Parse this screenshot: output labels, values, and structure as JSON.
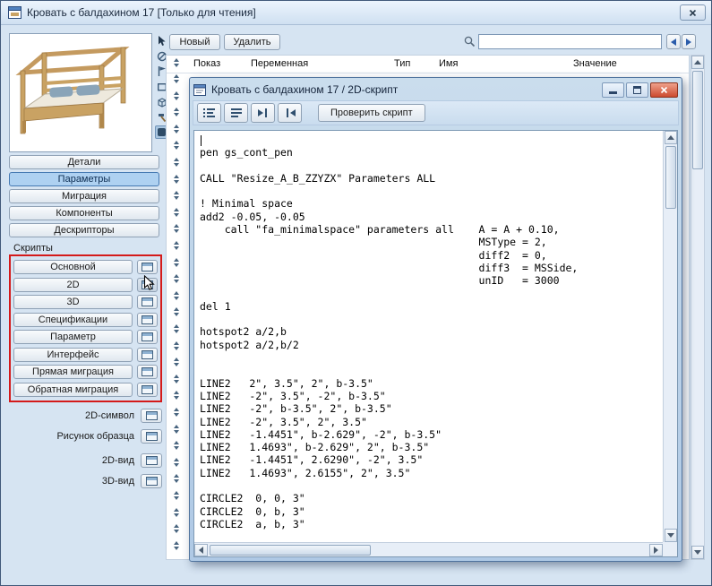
{
  "window": {
    "title": "Кровать с балдахином 17 [Только для чтения]"
  },
  "toolbar": {
    "new": "Новый",
    "delete": "Удалить",
    "search_value": ""
  },
  "param_table": {
    "columns": [
      "Показ",
      "Переменная",
      "Тип",
      "Имя",
      "Значение"
    ]
  },
  "sidebar": {
    "tabs": [
      "Детали",
      "Параметры",
      "Миграция",
      "Компоненты",
      "Дескрипторы"
    ],
    "selected_tab": "Параметры",
    "scripts_label": "Скрипты",
    "script_buttons": [
      "Основной",
      "2D",
      "3D",
      "Спецификации",
      "Параметр",
      "Интерфейс",
      "Прямая миграция",
      "Обратная миграция"
    ],
    "preview_rows": [
      "2D-символ",
      "Рисунок образца",
      "2D-вид",
      "3D-вид"
    ]
  },
  "script_window": {
    "title": "Кровать с балдахином 17 / 2D-скрипт",
    "check_script": "Проверить скрипт",
    "code": "\npen gs_cont_pen\n\nCALL \"Resize_A_B_ZZYZX\" Parameters ALL\n\n! Minimal space\nadd2 -0.05, -0.05\n    call \"fa_minimalspace\" parameters all    A = A + 0.10,\n                                             MSType = 2,\n                                             diff2  = 0,\n                                             diff3  = MSSide,\n                                             unID   = 3000\n\ndel 1\n\nhotspot2 a/2,b\nhotspot2 a/2,b/2\n\n\nLINE2   2\", 3.5\", 2\", b-3.5\"\nLINE2   -2\", 3.5\", -2\", b-3.5\"\nLINE2   -2\", b-3.5\", 2\", b-3.5\"\nLINE2   -2\", 3.5\", 2\", 3.5\"\nLINE2   -1.4451\", b-2.629\", -2\", b-3.5\"\nLINE2   1.4693\", b-2.629\", 2\", b-3.5\"\nLINE2   -1.4451\", 2.6290\", -2\", 3.5\"\nLINE2   1.4693\", 2.6155\", 2\", 3.5\"\n\nCIRCLE2  0, 0, 3\"\nCIRCLE2  0, b, 3\"\nCIRCLE2  a, b, 3\""
  },
  "icons": {
    "search-icon": "magnifying-glass",
    "nav-left-icon": "blue-left-triangle",
    "nav-right-icon": "blue-right-triangle",
    "close-icon": "x-cross",
    "minimize-icon": "bar",
    "maximize-icon": "square",
    "window-icon": "mini-window",
    "row-reorder-icon": "up-down-arrows"
  },
  "colors": {
    "frame_bg": "#d6e4f2",
    "selected_tab_bg": "#aed1f1",
    "red_outline": "#d41a1a",
    "close_red": "#cc4a2e",
    "accent_blue": "#2a5cab"
  }
}
